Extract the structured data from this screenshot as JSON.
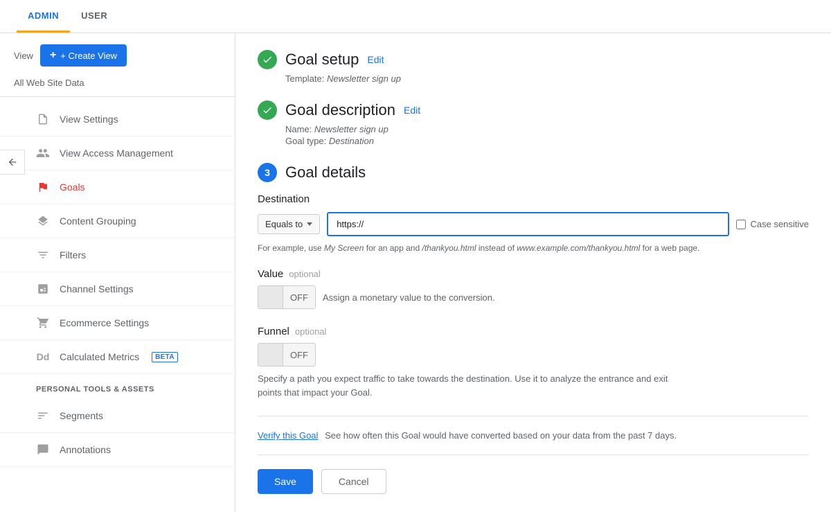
{
  "topNav": {
    "tabs": [
      {
        "id": "admin",
        "label": "ADMIN",
        "active": true
      },
      {
        "id": "user",
        "label": "USER",
        "active": false
      }
    ]
  },
  "sidebar": {
    "viewLabel": "View",
    "createViewBtn": "+ Create View",
    "allWebSiteData": "All Web Site Data",
    "items": [
      {
        "id": "view-settings",
        "label": "View Settings",
        "iconType": "document",
        "active": false
      },
      {
        "id": "view-access-management",
        "label": "View Access Management",
        "iconType": "people",
        "active": false
      },
      {
        "id": "goals",
        "label": "Goals",
        "iconType": "flag",
        "active": true
      },
      {
        "id": "content-grouping",
        "label": "Content Grouping",
        "iconType": "layers",
        "active": false
      },
      {
        "id": "filters",
        "label": "Filters",
        "iconType": "filter",
        "active": false
      },
      {
        "id": "channel-settings",
        "label": "Channel Settings",
        "iconType": "chart",
        "active": false
      },
      {
        "id": "ecommerce-settings",
        "label": "Ecommerce Settings",
        "iconType": "cart",
        "active": false
      },
      {
        "id": "calculated-metrics",
        "label": "Calculated Metrics",
        "iconType": "dd",
        "active": false,
        "badge": "BETA"
      }
    ],
    "personalToolsHeader": "PERSONAL TOOLS & ASSETS",
    "personalItems": [
      {
        "id": "segments",
        "label": "Segments",
        "iconType": "segments"
      },
      {
        "id": "annotations",
        "label": "Annotations",
        "iconType": "annotations"
      }
    ]
  },
  "goalSetup": {
    "title": "Goal setup",
    "editLabel": "Edit",
    "templateLabel": "Template:",
    "templateValue": "Newsletter sign up"
  },
  "goalDescription": {
    "title": "Goal description",
    "editLabel": "Edit",
    "nameLabel": "Name:",
    "nameValue": "Newsletter sign up",
    "goalTypeLabel": "Goal type:",
    "goalTypeValue": "Destination"
  },
  "goalDetails": {
    "stepNumber": "3",
    "title": "Goal details",
    "destinationLabel": "Destination",
    "equalsTo": "Equals to",
    "urlValue": "https://",
    "caseSensitiveLabel": "Case sensitive",
    "helpText": "For example, use My Screen for an app and /thankyou.html instead of www.example.com/thankyou.html for a web page.",
    "valueLabel": "Value",
    "valueOptional": "optional",
    "valueToggleOff": "OFF",
    "valueDescription": "Assign a monetary value to the conversion.",
    "funnelLabel": "Funnel",
    "funnelOptional": "optional",
    "funnelToggleOff": "OFF",
    "funnelDescription": "Specify a path you expect traffic to take towards the destination. Use it to analyze the entrance and exit points that impact your Goal.",
    "verifyLinkText": "Verify this Goal",
    "verifyDescription": "See how often this Goal would have converted based on your data from the past 7 days.",
    "saveLabel": "Save",
    "cancelLabel": "Cancel"
  }
}
